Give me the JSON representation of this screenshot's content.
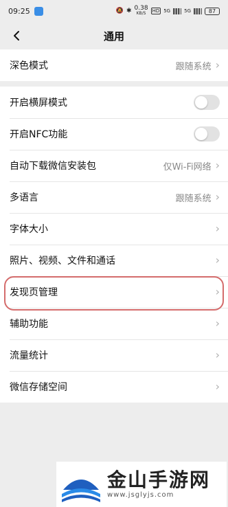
{
  "status_bar": {
    "time": "09:25",
    "speed": "0.38",
    "speed_unit": "KB/S",
    "network_hd": "HD",
    "signal1": "5G",
    "signal2": "5G",
    "battery": "87"
  },
  "nav": {
    "title": "通用"
  },
  "rows": {
    "dark_mode": {
      "label": "深色模式",
      "value": "跟随系统"
    },
    "landscape": {
      "label": "开启横屏模式",
      "on": false
    },
    "nfc": {
      "label": "开启NFC功能",
      "on": false
    },
    "auto_download": {
      "label": "自动下载微信安装包",
      "value": "仅Wi-Fi网络"
    },
    "language": {
      "label": "多语言",
      "value": "跟随系统"
    },
    "font_size": {
      "label": "字体大小"
    },
    "media": {
      "label": "照片、视频、文件和通话"
    },
    "discover": {
      "label": "发现页管理"
    },
    "accessibility": {
      "label": "辅助功能"
    },
    "data_usage": {
      "label": "流量统计"
    },
    "storage": {
      "label": "微信存储空间"
    }
  },
  "chevron": "›",
  "watermark": {
    "title": "金山手游网",
    "url": "www.jsglyjs.com"
  },
  "colors": {
    "background": "#ededed",
    "highlight_border": "#d46b6b",
    "toggle_off": "#e2e2e2"
  }
}
